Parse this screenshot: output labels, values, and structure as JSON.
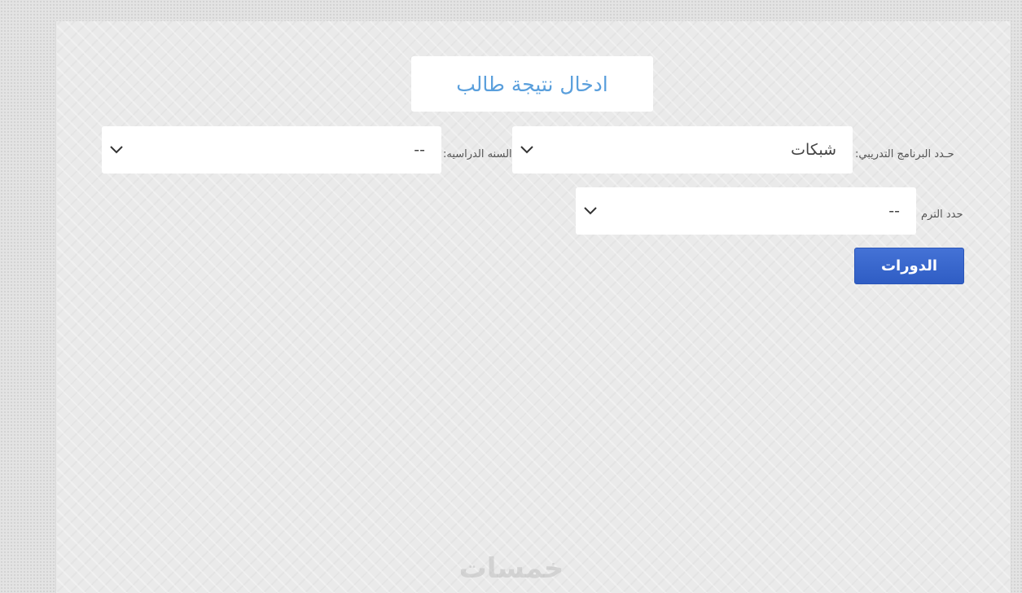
{
  "header": {
    "title": "ادخال نتيجة طالب"
  },
  "form": {
    "program": {
      "label": "حـدد البرنامج التدريبي:",
      "value": "شبكات"
    },
    "year": {
      "label": "السنه الدراسيه:",
      "value": "--"
    },
    "term": {
      "label": "حدد الترم",
      "value": "--"
    },
    "submit_label": "الدورات"
  },
  "watermark": {
    "text": "خمسات"
  },
  "colors": {
    "title": "#5a9fdc",
    "button": "#3a67cf",
    "background": "#e3e3e3"
  },
  "icons": {
    "dropdown": "chevron-down-icon"
  }
}
